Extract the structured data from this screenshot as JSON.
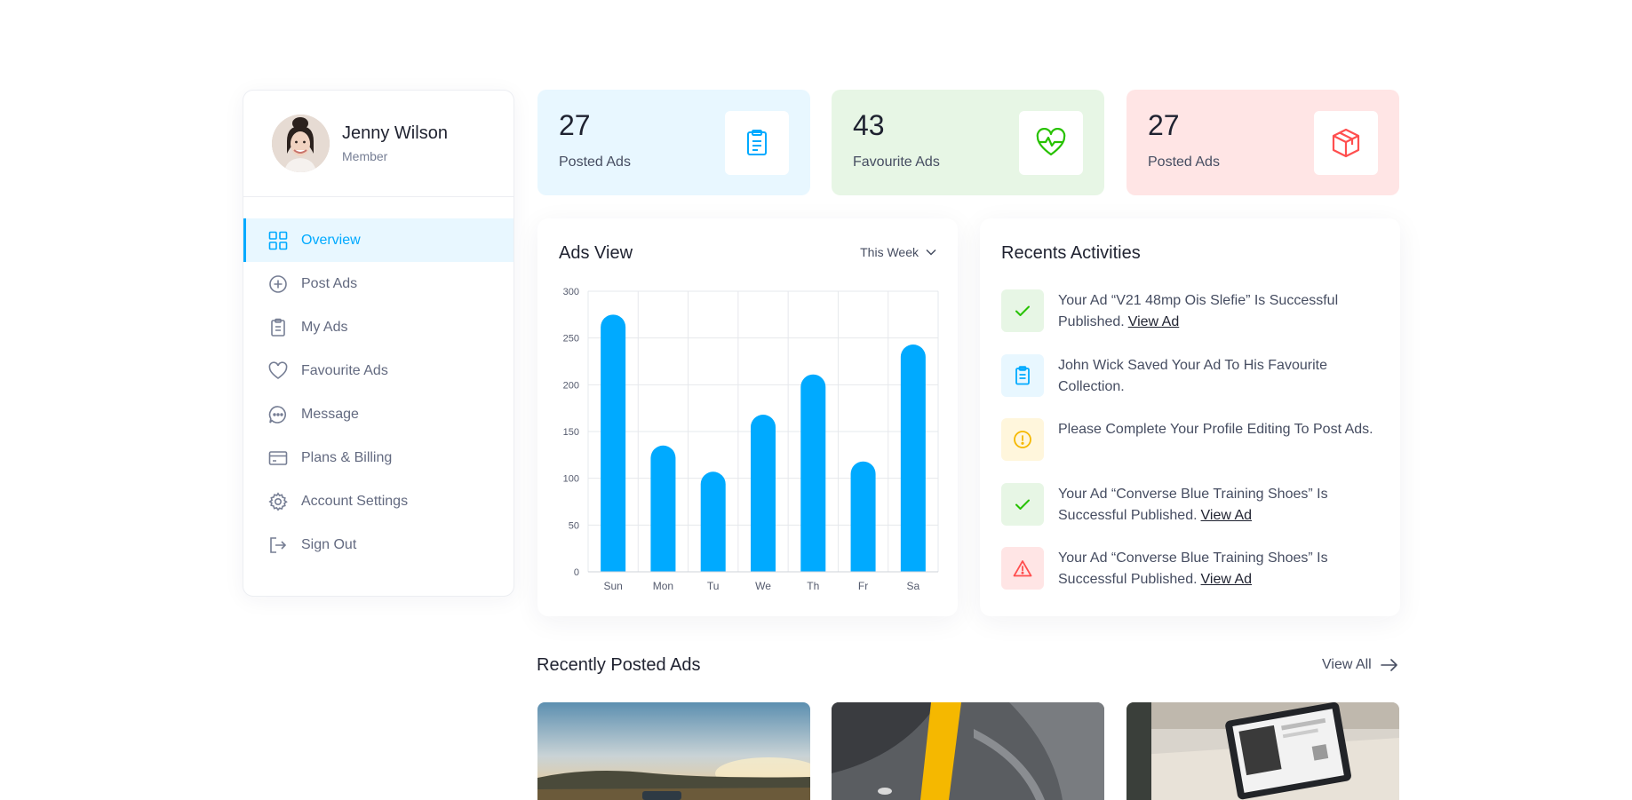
{
  "profile": {
    "name": "Jenny Wilson",
    "role": "Member"
  },
  "nav": [
    {
      "label": "Overview",
      "icon": "grid-icon",
      "active": true
    },
    {
      "label": "Post Ads",
      "icon": "plus-circle-icon"
    },
    {
      "label": "My Ads",
      "icon": "clipboard-icon"
    },
    {
      "label": "Favourite Ads",
      "icon": "heart-icon"
    },
    {
      "label": "Message",
      "icon": "chat-icon"
    },
    {
      "label": "Plans & Billing",
      "icon": "credit-card-icon"
    },
    {
      "label": "Account Settings",
      "icon": "gear-icon"
    },
    {
      "label": "Sign Out",
      "icon": "sign-out-icon"
    }
  ],
  "stats": [
    {
      "value": "27",
      "label": "Posted Ads",
      "icon": "clipboard-icon",
      "bg": "#e8f7ff",
      "color": "#00aaff"
    },
    {
      "value": "43",
      "label": "Favourite Ads",
      "icon": "heartbeat-icon",
      "bg": "#e7f6e5",
      "color": "#27c200"
    },
    {
      "value": "27",
      "label": "Posted Ads",
      "icon": "package-icon",
      "bg": "#ffe5e5",
      "color": "#ff4f4f"
    }
  ],
  "ads_view": {
    "title": "Ads View",
    "period": "This Week"
  },
  "chart_data": {
    "type": "bar",
    "categories": [
      "Sun",
      "Mon",
      "Tu",
      "We",
      "Th",
      "Fr",
      "Sa"
    ],
    "values": [
      275,
      135,
      107,
      168,
      211,
      118,
      243
    ],
    "ylim": [
      0,
      300
    ],
    "yticks": [
      0,
      50,
      100,
      150,
      200,
      250,
      300
    ],
    "grid": true,
    "color": "#00aaff"
  },
  "activities": {
    "title": "Recents Activities",
    "items": [
      {
        "text": "Your Ad “V21 48mp Ois Slefie” Is Successful Published.",
        "link": "View Ad",
        "icon": "check-icon",
        "bg": "#e7f6e5",
        "color": "#27c200"
      },
      {
        "text": "John Wick Saved Your Ad To His Favourite Collection.",
        "link": "",
        "icon": "clipboard-icon",
        "bg": "#e8f7ff",
        "color": "#00aaff"
      },
      {
        "text": "Please Complete Your Profile Editing To Post Ads.",
        "link": "",
        "icon": "info-icon",
        "bg": "#fff6dc",
        "color": "#f5b800"
      },
      {
        "text": "Your Ad “Converse Blue Training Shoes” Is Successful Published.",
        "link": "View Ad",
        "icon": "check-icon",
        "bg": "#e7f6e5",
        "color": "#27c200"
      },
      {
        "text": "Your Ad “Converse Blue Training Shoes” Is Successful Published.",
        "link": "View Ad",
        "icon": "warning-icon",
        "bg": "#ffe5e5",
        "color": "#ff4f4f"
      }
    ]
  },
  "recent_ads": {
    "title": "Recently Posted Ads",
    "view_all": "View All"
  }
}
